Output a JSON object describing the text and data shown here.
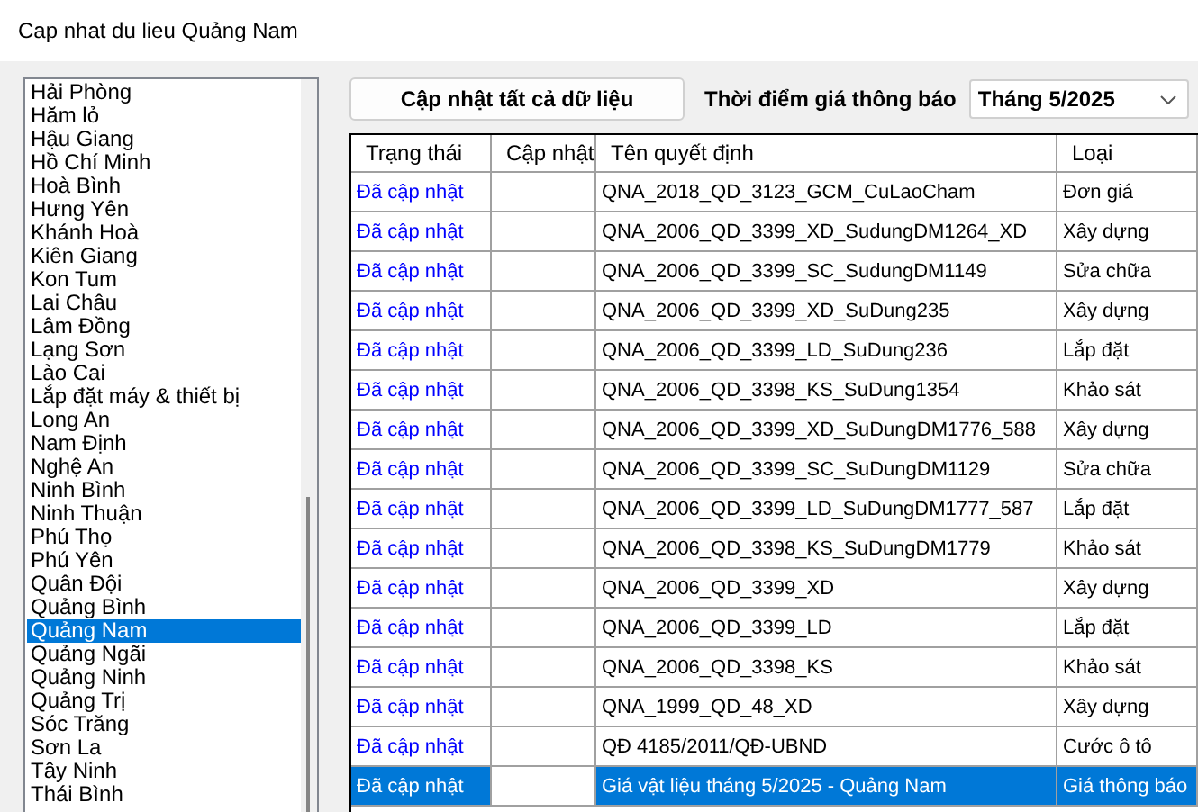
{
  "window": {
    "title": "Cap nhat du lieu Quảng Nam"
  },
  "provinces": [
    {
      "label": "Hải Phòng",
      "selected": false
    },
    {
      "label": "Hăm lỏ",
      "selected": false
    },
    {
      "label": "Hậu Giang",
      "selected": false
    },
    {
      "label": "Hồ Chí Minh",
      "selected": false
    },
    {
      "label": "Hoà Bình",
      "selected": false
    },
    {
      "label": "Hưng Yên",
      "selected": false
    },
    {
      "label": "Khánh Hoà",
      "selected": false
    },
    {
      "label": "Kiên Giang",
      "selected": false
    },
    {
      "label": "Kon Tum",
      "selected": false
    },
    {
      "label": "Lai Châu",
      "selected": false
    },
    {
      "label": "Lâm Đồng",
      "selected": false
    },
    {
      "label": "Lạng Sơn",
      "selected": false
    },
    {
      "label": "Lào Cai",
      "selected": false
    },
    {
      "label": "Lắp đặt máy & thiết bị",
      "selected": false
    },
    {
      "label": "Long An",
      "selected": false
    },
    {
      "label": "Nam Định",
      "selected": false
    },
    {
      "label": "Nghệ An",
      "selected": false
    },
    {
      "label": "Ninh Bình",
      "selected": false
    },
    {
      "label": "Ninh Thuận",
      "selected": false
    },
    {
      "label": "Phú Thọ",
      "selected": false
    },
    {
      "label": "Phú Yên",
      "selected": false
    },
    {
      "label": "Quân Đội",
      "selected": false
    },
    {
      "label": "Quảng Bình",
      "selected": false
    },
    {
      "label": "Quảng Nam",
      "selected": true
    },
    {
      "label": "Quảng Ngãi",
      "selected": false
    },
    {
      "label": "Quảng Ninh",
      "selected": false
    },
    {
      "label": "Quảng Trị",
      "selected": false
    },
    {
      "label": "Sóc Trăng",
      "selected": false
    },
    {
      "label": "Sơn La",
      "selected": false
    },
    {
      "label": "Tây Ninh",
      "selected": false
    },
    {
      "label": "Thái Bình",
      "selected": false
    }
  ],
  "update_all_button": "Cập nhật tất cả dữ liệu",
  "period": {
    "label": "Thời điểm giá thông báo",
    "value": "Tháng 5/2025"
  },
  "table": {
    "columns": [
      "Trạng thái",
      "Cập nhật",
      "Tên quyết định",
      "Loại"
    ],
    "rows": [
      {
        "status": "Đã cập nhật",
        "name": "QNA_2018_QD_3123_GCM_CuLaoCham",
        "type": "Đơn giá",
        "selected": false
      },
      {
        "status": "Đã cập nhật",
        "name": "QNA_2006_QD_3399_XD_SudungDM1264_XD",
        "type": "Xây dựng",
        "selected": false
      },
      {
        "status": "Đã cập nhật",
        "name": "QNA_2006_QD_3399_SC_SudungDM1149",
        "type": "Sửa chữa",
        "selected": false
      },
      {
        "status": "Đã cập nhật",
        "name": "QNA_2006_QD_3399_XD_SuDung235",
        "type": "Xây dựng",
        "selected": false
      },
      {
        "status": "Đã cập nhật",
        "name": "QNA_2006_QD_3399_LD_SuDung236",
        "type": "Lắp đặt",
        "selected": false
      },
      {
        "status": "Đã cập nhật",
        "name": "QNA_2006_QD_3398_KS_SuDung1354",
        "type": "Khảo sát",
        "selected": false
      },
      {
        "status": "Đã cập nhật",
        "name": "QNA_2006_QD_3399_XD_SuDungDM1776_588",
        "type": "Xây dựng",
        "selected": false
      },
      {
        "status": "Đã cập nhật",
        "name": "QNA_2006_QD_3399_SC_SuDungDM1129",
        "type": "Sửa chữa",
        "selected": false
      },
      {
        "status": "Đã cập nhật",
        "name": "QNA_2006_QD_3399_LD_SuDungDM1777_587",
        "type": "Lắp đặt",
        "selected": false
      },
      {
        "status": "Đã cập nhật",
        "name": "QNA_2006_QD_3398_KS_SuDungDM1779",
        "type": "Khảo sát",
        "selected": false
      },
      {
        "status": "Đã cập nhật",
        "name": "QNA_2006_QD_3399_XD",
        "type": "Xây dựng",
        "selected": false
      },
      {
        "status": "Đã cập nhật",
        "name": "QNA_2006_QD_3399_LD",
        "type": "Lắp đặt",
        "selected": false
      },
      {
        "status": "Đã cập nhật",
        "name": "QNA_2006_QD_3398_KS",
        "type": "Khảo sát",
        "selected": false
      },
      {
        "status": "Đã cập nhật",
        "name": "QNA_1999_QD_48_XD",
        "type": "Xây dựng",
        "selected": false
      },
      {
        "status": "Đã cập nhật",
        "name": "QĐ 4185/2011/QĐ-UBND",
        "type": "Cước ô tô",
        "selected": false
      },
      {
        "status": "Đã cập nhật",
        "name": "Giá vật liệu tháng 5/2025 - Quảng Nam",
        "type": "Giá thông báo",
        "selected": true
      }
    ]
  }
}
